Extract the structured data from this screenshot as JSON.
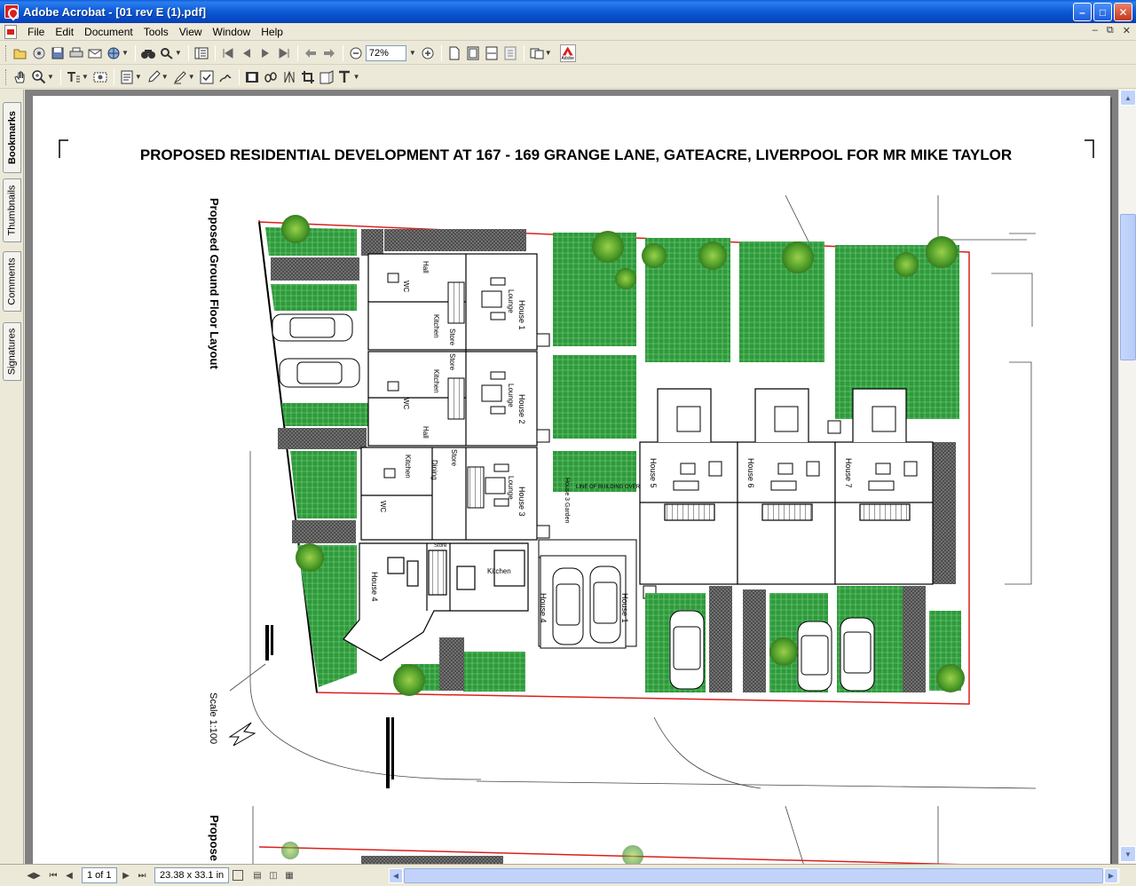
{
  "window": {
    "title": "Adobe Acrobat - [01 rev E (1).pdf]",
    "minimize": "–",
    "maximize": "□",
    "close": "✕"
  },
  "menu": [
    "File",
    "Edit",
    "Document",
    "Tools",
    "View",
    "Window",
    "Help"
  ],
  "toolbar": {
    "zoom_value": "72%"
  },
  "adobe_logo_text": "Adobe",
  "side_tabs": [
    "Bookmarks",
    "Thumbnails",
    "Comments",
    "Signatures"
  ],
  "drawing": {
    "title": "PROPOSED RESIDENTIAL DEVELOPMENT AT 167 - 169 GRANGE LANE, GATEACRE, LIVERPOOL  FOR MR MIKE TAYLOR",
    "layout_label": "Proposed Ground Floor Layout",
    "scale_label": "Scale  1:100",
    "next_label": "Propose",
    "houses": [
      "House 1",
      "House 2",
      "House 3",
      "House 4",
      "House 5",
      "House 6",
      "House 7"
    ],
    "rooms": {
      "lounge": "Lounge",
      "kitchen": "Kitchen",
      "hall": "Hall",
      "wc": "WC",
      "store": "Store",
      "dining": "Dining",
      "bin": "Bin"
    },
    "garden_label": "House 3 Garden",
    "building_line": "LINE OF BUILDING OVER"
  },
  "status": {
    "page": "1 of 1",
    "size": "23.38 x 33.1 in"
  },
  "colors": {
    "titlebar": "#0a5fd8",
    "lawn": "#2e9a3a",
    "boundary": "#d9201c"
  }
}
